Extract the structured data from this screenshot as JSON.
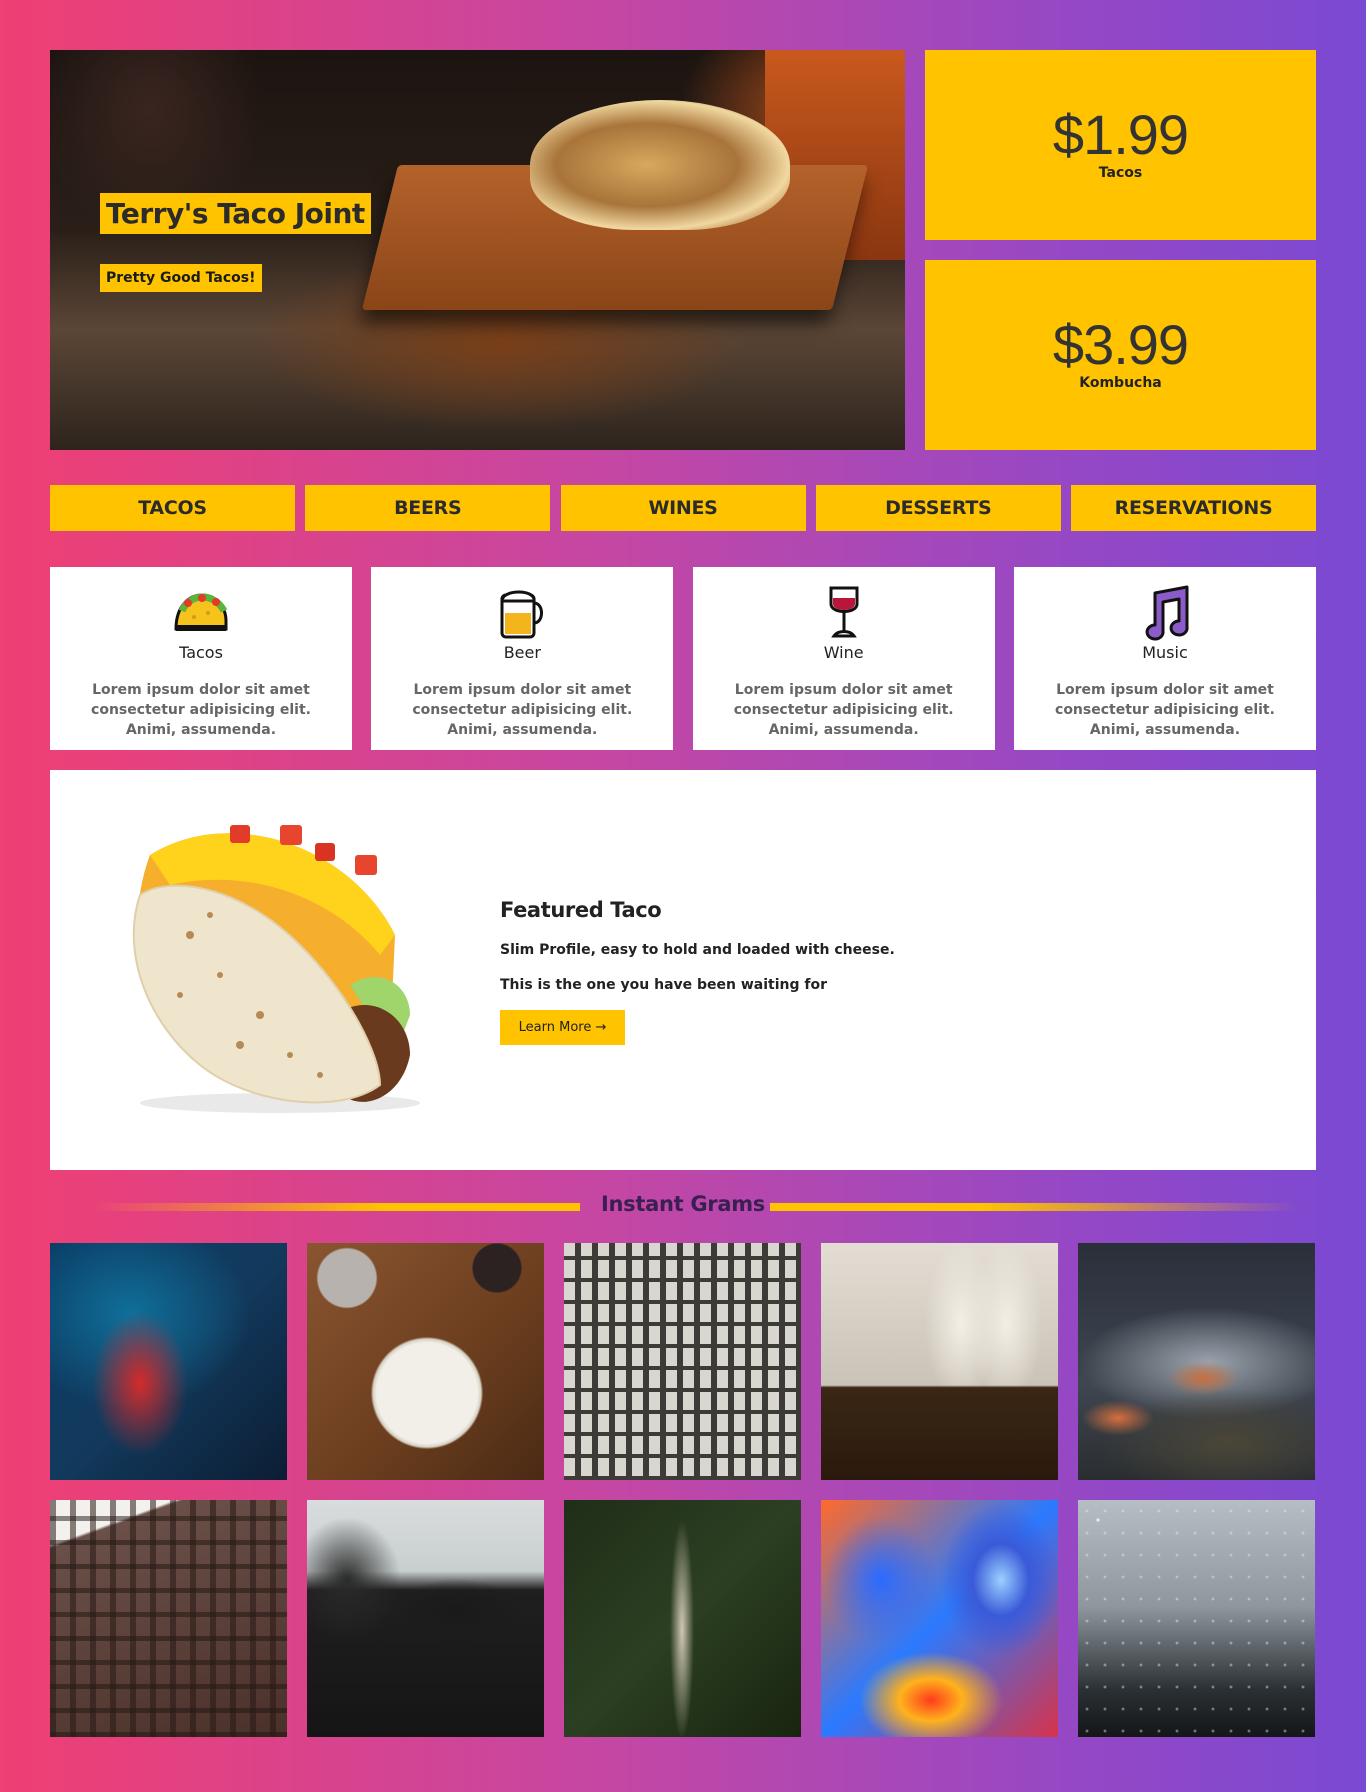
{
  "hero": {
    "title": "Terry's Taco Joint",
    "subtitle": "Pretty Good Tacos!"
  },
  "prices": [
    {
      "amount": "$1.99",
      "label": "Tacos"
    },
    {
      "amount": "$3.99",
      "label": "Kombucha"
    }
  ],
  "nav": [
    "TACOS",
    "BEERS",
    "WINES",
    "DESSERTS",
    "RESERVATIONS"
  ],
  "cards": [
    {
      "icon": "taco-icon",
      "title": "Tacos",
      "text": "Lorem ipsum dolor sit amet consectetur adipisicing elit. Animi, assumenda."
    },
    {
      "icon": "beer-icon",
      "title": "Beer",
      "text": "Lorem ipsum dolor sit amet consectetur adipisicing elit. Animi, assumenda."
    },
    {
      "icon": "wine-glass-icon",
      "title": "Wine",
      "text": "Lorem ipsum dolor sit amet consectetur adipisicing elit. Animi, assumenda."
    },
    {
      "icon": "music-note-icon",
      "title": "Music",
      "text": "Lorem ipsum dolor sit amet consectetur adipisicing elit. Animi, assumenda."
    }
  ],
  "featured": {
    "title": "Featured Taco",
    "line1": "Slim Profile, easy to hold and loaded with cheese.",
    "line2": "This is the one you have been waiting for",
    "button": "Learn More →"
  },
  "grams": {
    "heading": "Instant Grams"
  },
  "colors": {
    "accent": "#ffc300",
    "gradient_left": "#ef3f73",
    "gradient_right": "#7a49d3"
  }
}
